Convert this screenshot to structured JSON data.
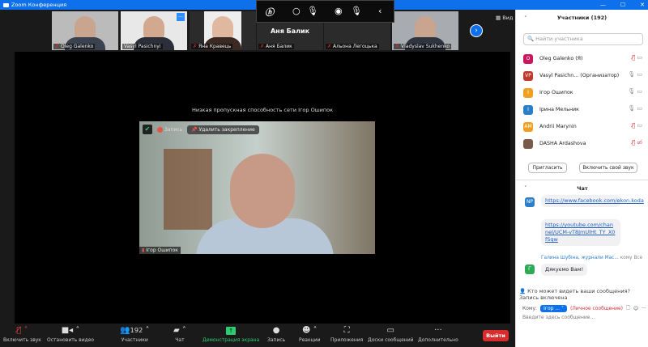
{
  "window": {
    "title": "Zoom Конференция",
    "controls": [
      "—",
      "☐",
      "✕"
    ]
  },
  "thumbnails": [
    {
      "name": "Oleg Galenko",
      "video": true
    },
    {
      "name": "Vasyl Pasichnyi",
      "video": true
    },
    {
      "name": "Яна Кравець",
      "video": true
    },
    {
      "name": "Аня Балик",
      "video": false,
      "big_label": "Аня Балик"
    },
    {
      "name": "Альона Легоцька",
      "video": false
    },
    {
      "name": "Vladyslav Sukhenko",
      "video": true
    }
  ],
  "view_label": "Вид",
  "hp_logo": "hp",
  "main": {
    "warning": "Низкая пропускная способность сети Ігор Ошипок",
    "record_label": "Запись",
    "unpin_label": "Удалить закрепление",
    "speaker_name": "Ігор Ошипок"
  },
  "toolbar": {
    "items": [
      {
        "label": "Включить звук",
        "icon": "mic-muted-icon"
      },
      {
        "label": "Остановить видео",
        "icon": "video-icon"
      },
      {
        "label": "Участники",
        "icon": "participants-icon",
        "count": "192"
      },
      {
        "label": "Чат",
        "icon": "chat-icon"
      },
      {
        "label": "Демонстрация экрана",
        "icon": "share-screen-icon"
      },
      {
        "label": "Запись",
        "icon": "record-icon"
      },
      {
        "label": "Реакции",
        "icon": "reactions-icon"
      },
      {
        "label": "Приложения",
        "icon": "apps-icon"
      },
      {
        "label": "Доски сообщений",
        "icon": "whiteboard-icon"
      },
      {
        "label": "Дополнительно",
        "icon": "more-icon"
      }
    ],
    "leave": "Выйти"
  },
  "participants": {
    "title": "Участники (192)",
    "search_placeholder": "Найти участника",
    "list": [
      {
        "initials": "O",
        "name": "Oleg Galenko (Я)",
        "color": "#c8175e",
        "mic": "muted"
      },
      {
        "initials": "VP",
        "name": "Vasyl Pasichn... (Организатор)",
        "color": "#c0392b",
        "mic": "on"
      },
      {
        "initials": "І",
        "name": "Ігор Ошипок",
        "color": "#f0a020",
        "mic": "on"
      },
      {
        "initials": "І",
        "name": "Ірина Мельник",
        "color": "#2d7ec9",
        "mic": "on"
      },
      {
        "initials": "AM",
        "name": "Andrii Marynin",
        "color": "#f0a020",
        "mic": "muted"
      },
      {
        "initials": "",
        "name": "DASHA Ardashova",
        "color": "#7a5a4a",
        "mic": "muted"
      }
    ],
    "invite": "Пригласить",
    "unmute_self": "Включить свой звук"
  },
  "chat": {
    "title": "Чат",
    "messages": [
      {
        "avatar": "NP",
        "text": "https://www.facebook.com/ekon.koda"
      },
      {
        "text": "https://youtube.com/channel/UCM-vT8JmUlHt_TY_X0fSqw"
      },
      {
        "sender": "Галина Шубіна, журнали Мас...",
        "to": "кому Все",
        "avatar": "Г",
        "text": "Дякуємо Вам!"
      }
    ],
    "notice": "Кто может видеть ваши сообщения? Запись включена",
    "to_label": "Кому:",
    "to_value": "Ігор ...",
    "private": "(Личное сообщение)",
    "input_placeholder": "Введите здесь сообщение..."
  }
}
